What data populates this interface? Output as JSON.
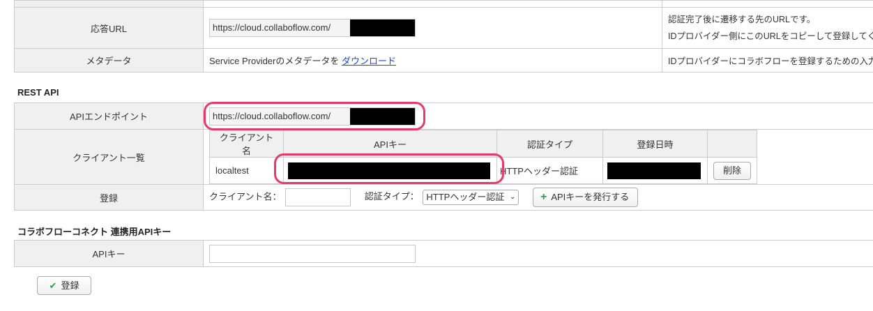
{
  "saml": {
    "response_url_label": "応答URL",
    "response_url_value": "https://cloud.collaboflow.com/",
    "response_url_desc1": "認証完了後に遷移する先のURLです。",
    "response_url_desc2": "IDプロバイダー側にこのURLをコピーして登録してください。",
    "metadata_label": "メタデータ",
    "metadata_text": "Service Providerのメタデータを",
    "metadata_link": "ダウンロード",
    "metadata_desc": "IDプロバイダーにコラボフローを登録するための入力値"
  },
  "rest_api": {
    "section_title": "REST API",
    "endpoint_label": "APIエンドポイント",
    "endpoint_value": "https://cloud.collaboflow.com/",
    "client_list_label": "クライアント一覧",
    "columns": [
      "クライアント名",
      "APIキー",
      "認証タイプ",
      "登録日時"
    ],
    "rows": [
      {
        "client": "localtest",
        "auth_type": "HTTPヘッダー認証",
        "delete_label": "削除"
      }
    ],
    "register_label": "登録",
    "client_name_label": "クライアント名：",
    "auth_type_label": "認証タイプ：",
    "auth_type_selected": "HTTPヘッダー認証",
    "issue_button": "APIキーを発行する"
  },
  "connect": {
    "section_title": "コラボフローコネクト 連携用APIキー",
    "api_key_label": "APIキー",
    "api_key_value": ""
  },
  "footer": {
    "register_button": "登録"
  },
  "colors": {
    "highlight": "#e8396a",
    "link": "#1a4ad9",
    "plus": "#2aa34a",
    "check": "#2aa34a"
  }
}
